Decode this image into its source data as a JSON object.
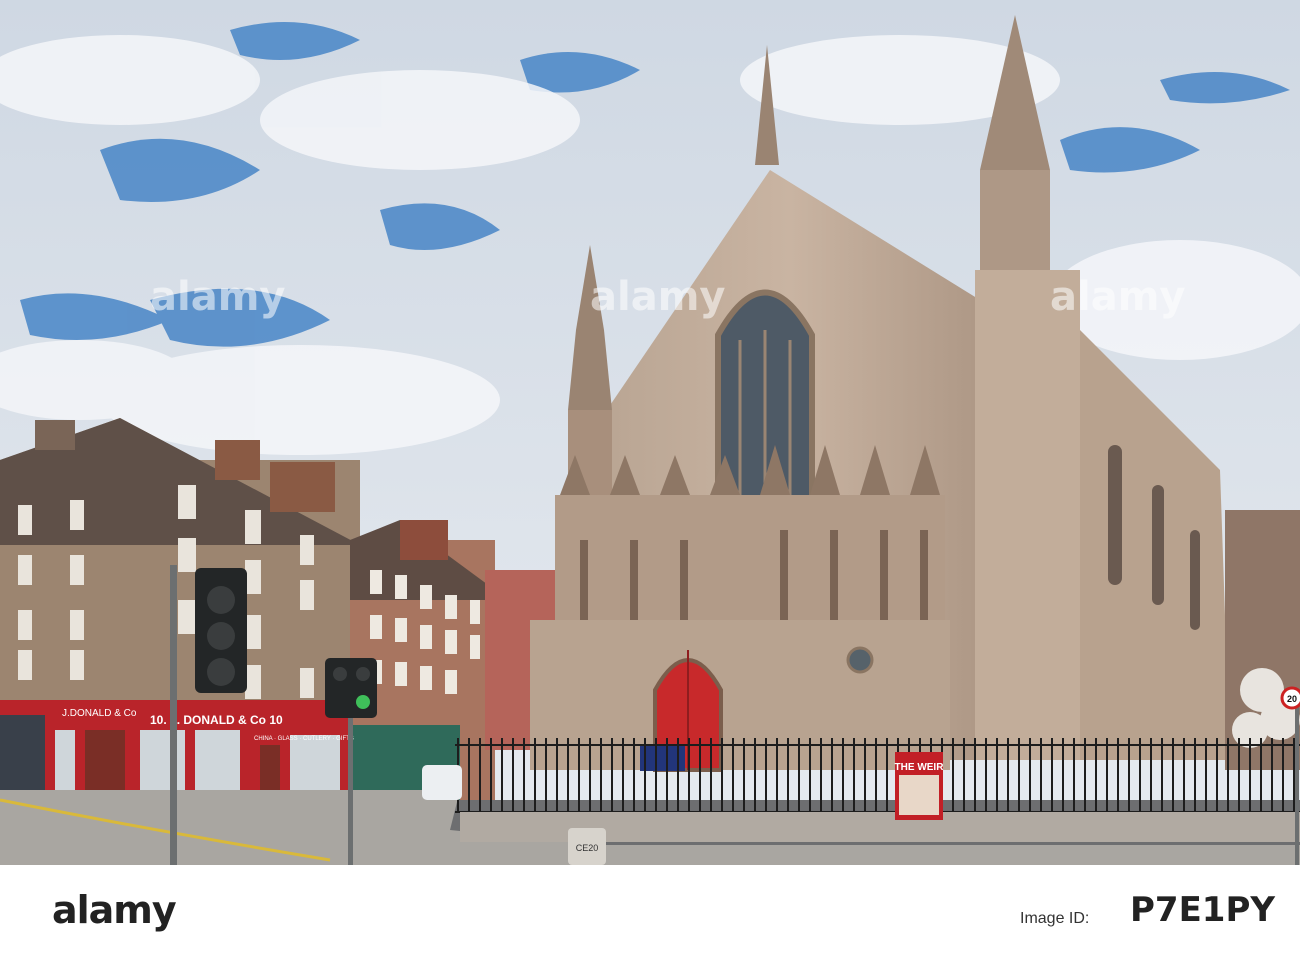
{
  "photo": {
    "watermark": "alamy",
    "shop_signs": [
      "J.DONALD & Co",
      "10. J. DONALD & Co 10",
      "CHINA · GLASS · CUTLERY · GIFTS"
    ],
    "poster_text": "THE WEIR",
    "bollard_text": "CE20",
    "speed_sign": "20"
  },
  "footer": {
    "brand": "alamy",
    "image_id_label": "Image ID:",
    "image_id": "P7E1PY"
  }
}
